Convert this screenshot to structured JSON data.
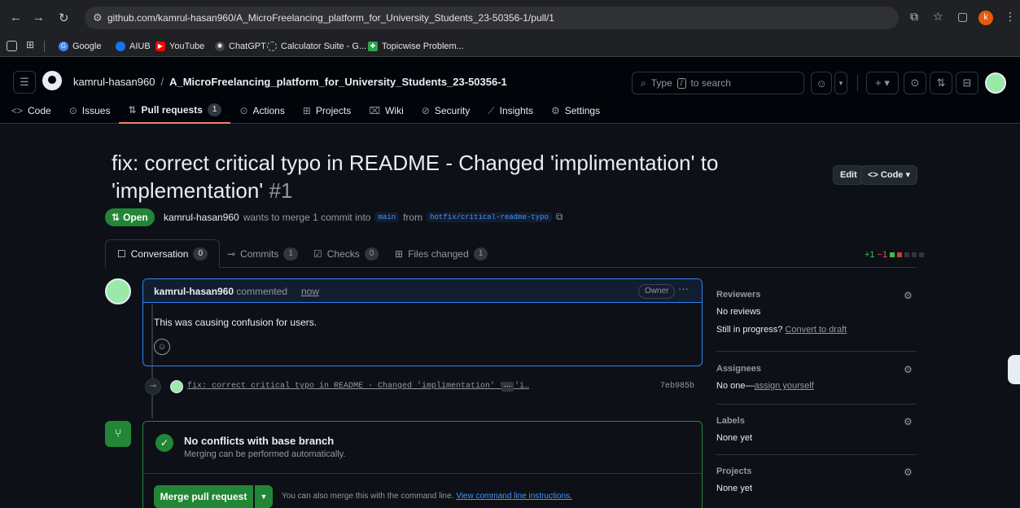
{
  "browser": {
    "url": "github.com/kamrul-hasan960/A_MicroFreelancing_platform_for_University_Students_23-50356-1/pull/1",
    "profile_initial": "k",
    "bookmarks": [
      {
        "label": "Google",
        "color": "#4285f4"
      },
      {
        "label": "AIUB",
        "color": "#1a73e8"
      },
      {
        "label": "YouTube",
        "color": "#ff0000"
      },
      {
        "label": "ChatGPT",
        "color": "#10a37f"
      },
      {
        "label": "Calculator Suite - G...",
        "color": "#8ab4f8"
      },
      {
        "label": "Topicwise Problem...",
        "color": "#2da44e"
      }
    ]
  },
  "header": {
    "owner": "kamrul-hasan960",
    "separator": "/",
    "repo": "A_MicroFreelancing_platform_for_University_Students_23-50356-1",
    "search_prefix": "Type",
    "search_key": "/",
    "search_suffix": "to search"
  },
  "repo_nav": {
    "code": "Code",
    "issues": "Issues",
    "pull_requests": "Pull requests",
    "pull_requests_count": "1",
    "actions": "Actions",
    "projects": "Projects",
    "wiki": "Wiki",
    "security": "Security",
    "insights": "Insights",
    "settings": "Settings"
  },
  "pr": {
    "title": "fix: correct critical typo in README - Changed 'implimentation' to 'implementation'",
    "number": "#1",
    "edit_label": "Edit",
    "code_label": "Code",
    "state": "Open",
    "author": "kamrul-hasan960",
    "merge_text_1": "wants to merge 1 commit into",
    "base_branch": "main",
    "merge_text_2": "from",
    "head_branch": "hotfix/critical-readme-typo"
  },
  "pr_tabs": {
    "conversation": "Conversation",
    "conversation_count": "0",
    "commits": "Commits",
    "commits_count": "1",
    "checks": "Checks",
    "checks_count": "0",
    "files": "Files changed",
    "files_count": "1",
    "additions": "+1",
    "deletions": "−1"
  },
  "comment": {
    "author": "kamrul-hasan960",
    "verb": "commented",
    "time": "now",
    "badge": "Owner",
    "body": "This was causing confusion for users."
  },
  "commit": {
    "message": "fix: correct critical typo in README - Changed 'implimentation' to 'i…",
    "more": "···",
    "sha": "7eb985b"
  },
  "merge": {
    "status_title": "No conflicts with base branch",
    "status_sub": "Merging can be performed automatically.",
    "button": "Merge pull request",
    "hint": "You can also merge this with the command line.",
    "hint_link": "View command line instructions."
  },
  "sidebar": {
    "reviewers_title": "Reviewers",
    "reviewers_value": "No reviews",
    "in_progress": "Still in progress?",
    "convert_link": "Convert to draft",
    "assignees_title": "Assignees",
    "assignees_value": "No one—",
    "assign_link": "assign yourself",
    "labels_title": "Labels",
    "labels_value": "None yet",
    "projects_title": "Projects",
    "projects_value": "None yet"
  }
}
